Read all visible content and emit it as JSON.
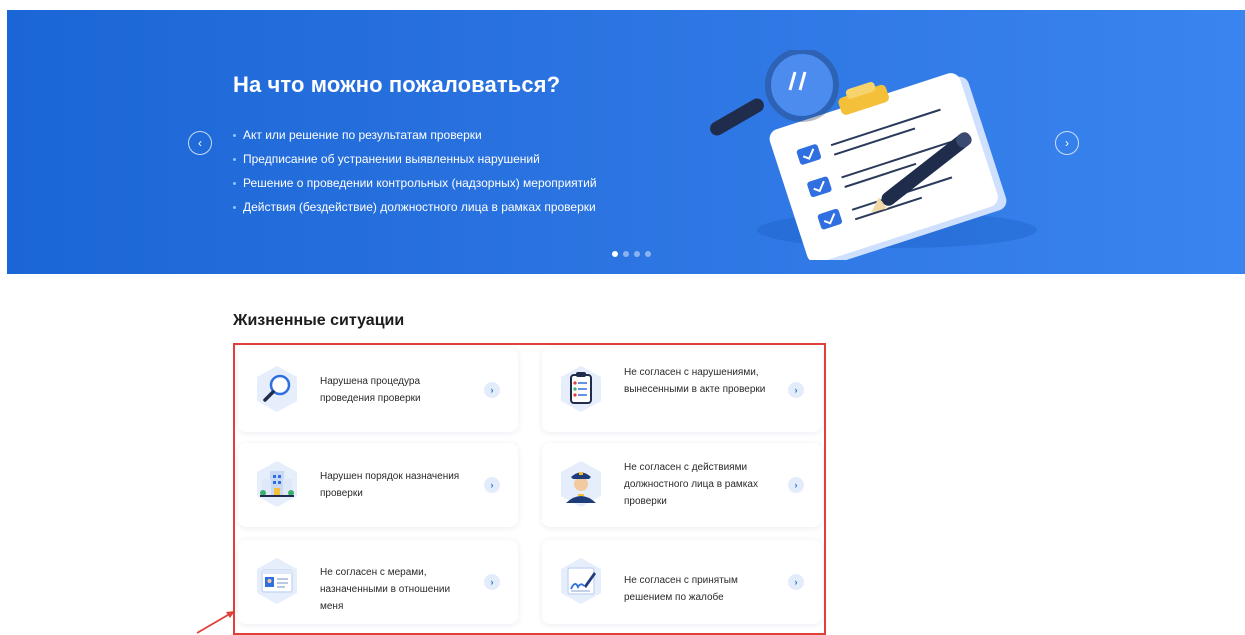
{
  "banner": {
    "title": "На что можно пожаловаться?",
    "items": [
      "Акт или решение по результатам проверки",
      "Предписание об устранении выявленных нарушений",
      "Решение о проведении контрольных (надзорных) мероприятий",
      "Действия (бездействие) должностного лица в рамках проверки"
    ],
    "prev_icon": "‹",
    "next_icon": "›",
    "active_slide": 1,
    "slide_count": 4
  },
  "situations": {
    "title": "Жизненные ситуации",
    "arrow_icon": "›",
    "cards": [
      {
        "icon": "magnifier-icon",
        "label": "Нарушена процедура проведения проверки"
      },
      {
        "icon": "clipboard-icon",
        "label": "Не согласен с нарушениями, вынесенными в акте проверки"
      },
      {
        "icon": "building-icon",
        "label": "Нарушен порядок назначения проверки"
      },
      {
        "icon": "officer-icon",
        "label": "Не согласен с действиями должностного лица в рамках проверки"
      },
      {
        "icon": "id-card-icon",
        "label": "Не согласен с мерами, назначенными в отношении меня"
      },
      {
        "icon": "signed-document-icon",
        "label": "Не согласен с принятым решением по жалобе"
      }
    ]
  },
  "colors": {
    "banner_start": "#1b66d6",
    "banner_end": "#3a84f0",
    "highlight_frame": "#e0403a",
    "accent": "#2a6ae0"
  }
}
